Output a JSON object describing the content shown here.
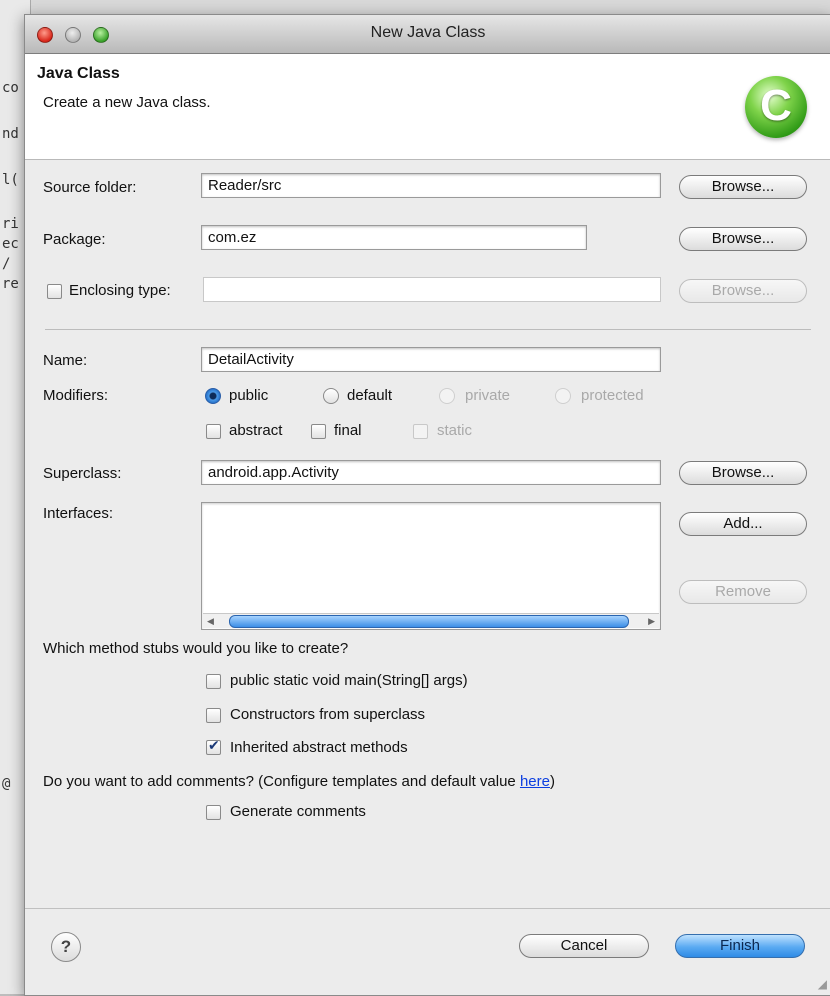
{
  "window": {
    "title": "New Java Class"
  },
  "banner": {
    "heading": "Java Class",
    "description": "Create a new Java class.",
    "logo_letter": "C"
  },
  "source_folder": {
    "label": "Source folder:",
    "value": "Reader/src",
    "browse": "Browse..."
  },
  "package": {
    "label": "Package:",
    "value": "com.ez",
    "browse": "Browse..."
  },
  "enclosing": {
    "label": "Enclosing type:",
    "value": "",
    "browse": "Browse...",
    "checked": false
  },
  "name": {
    "label": "Name:",
    "value": "DetailActivity"
  },
  "modifiers": {
    "label": "Modifiers:",
    "radios": [
      {
        "label": "public",
        "selected": true,
        "enabled": true
      },
      {
        "label": "default",
        "selected": false,
        "enabled": true
      },
      {
        "label": "private",
        "selected": false,
        "enabled": false
      },
      {
        "label": "protected",
        "selected": false,
        "enabled": false
      }
    ],
    "checks": [
      {
        "label": "abstract",
        "checked": false,
        "enabled": true
      },
      {
        "label": "final",
        "checked": false,
        "enabled": true
      },
      {
        "label": "static",
        "checked": false,
        "enabled": false
      }
    ]
  },
  "superclass": {
    "label": "Superclass:",
    "value": "android.app.Activity",
    "browse": "Browse..."
  },
  "interfaces": {
    "label": "Interfaces:",
    "add": "Add...",
    "remove": "Remove"
  },
  "stubs": {
    "question": "Which method stubs would you like to create?",
    "options": [
      {
        "label": "public static void main(String[] args)",
        "checked": false
      },
      {
        "label": "Constructors from superclass",
        "checked": false
      },
      {
        "label": "Inherited abstract methods",
        "checked": true
      }
    ]
  },
  "comments": {
    "question_prefix": "Do you want to add comments? (Configure templates and default value ",
    "link": "here",
    "question_suffix": ")",
    "option": {
      "label": "Generate comments",
      "checked": false
    }
  },
  "footer": {
    "help": "?",
    "cancel": "Cancel",
    "finish": "Finish"
  },
  "background_fragments": [
    "co",
    "nd",
    "l(",
    "ri",
    "ec",
    "/",
    "re",
    "@"
  ],
  "colors": {
    "primary_button": "#5aaaf2",
    "link": "#0b3ee0",
    "logo_green": "#3aa22a"
  }
}
